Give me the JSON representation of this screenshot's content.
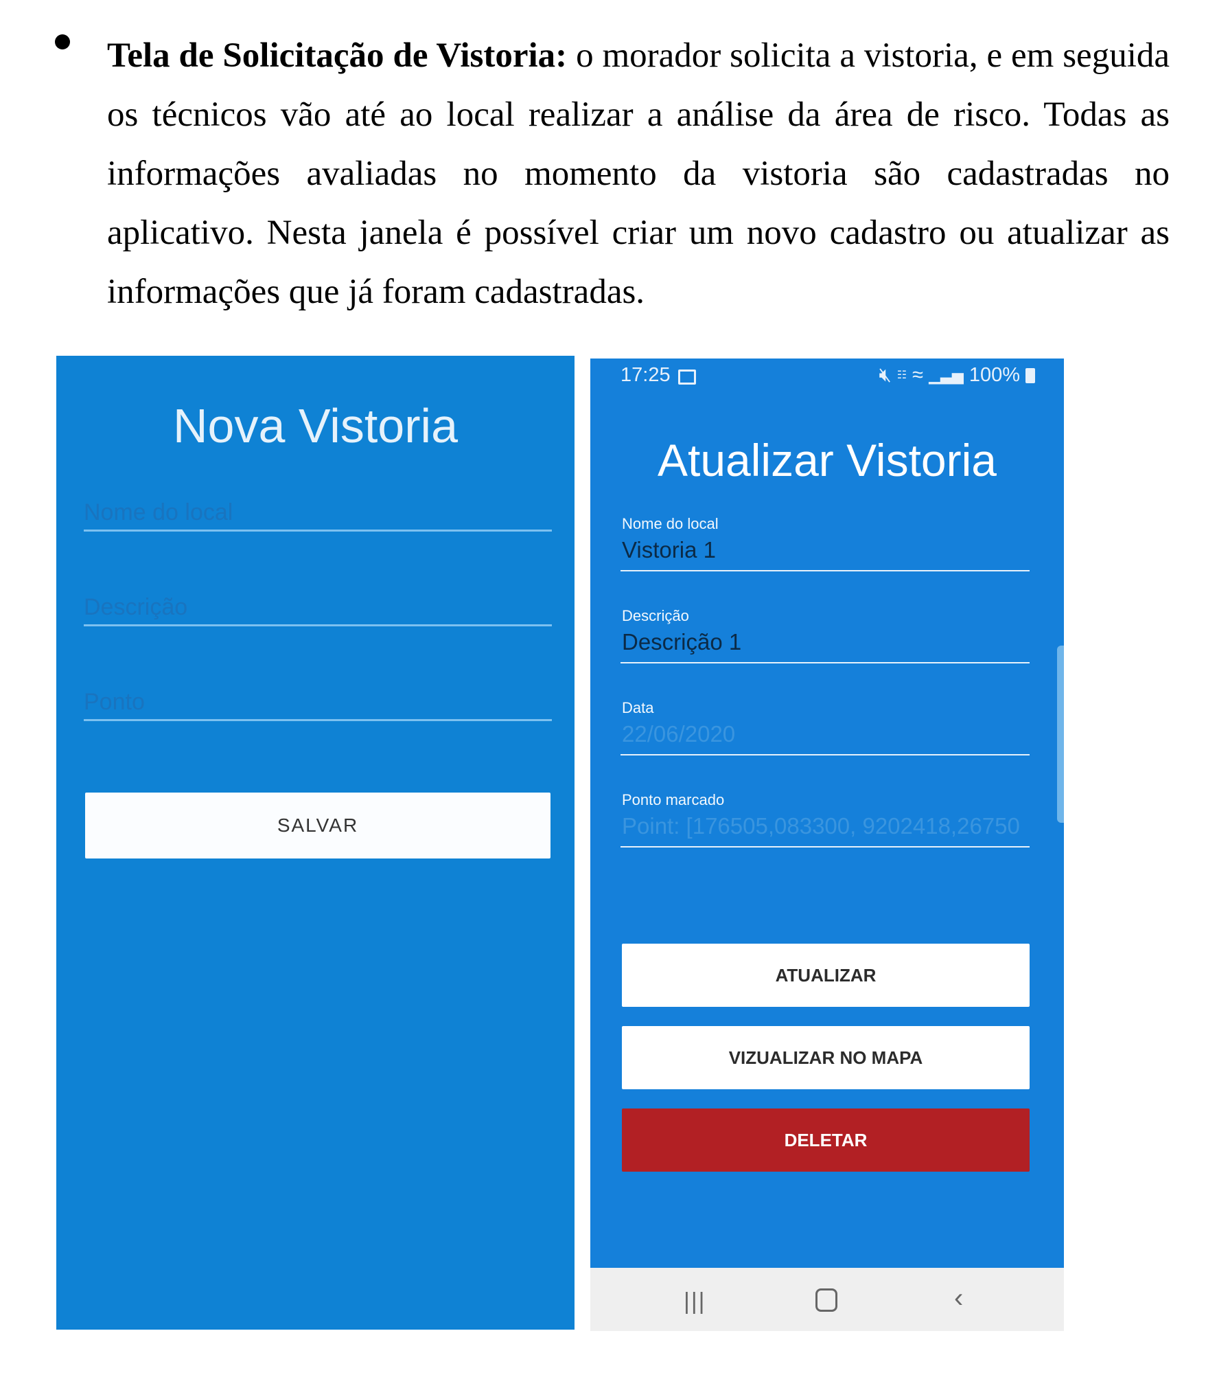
{
  "document": {
    "bold_lead": "Tela de Solicitação de Vistoria:",
    "body": " o morador solicita a vistoria, e em seguida os técnicos vão até ao local realizar a análise da área de risco. Todas as informações avaliadas no momento da vistoria são cadastradas no aplicativo. Nesta janela é possível criar um novo cadastro ou atualizar as informações que já foram cadastradas."
  },
  "nova_vistoria": {
    "title": "Nova Vistoria",
    "fields": [
      {
        "placeholder": "Nome do local"
      },
      {
        "placeholder": "Descrição"
      },
      {
        "placeholder": "Ponto"
      }
    ],
    "save_label": "SALVAR"
  },
  "atualizar_vistoria": {
    "status_bar": {
      "time": "17:25",
      "battery": "100%",
      "icons": [
        "gallery-icon",
        "mute-icon",
        "volte-icon",
        "wifi-icon",
        "signal-icon",
        "battery-icon"
      ]
    },
    "title": "Atualizar Vistoria",
    "fields": [
      {
        "label": "Nome do local",
        "value": "Vistoria 1"
      },
      {
        "label": "Descrição",
        "value": "Descrição 1"
      },
      {
        "label": "Data",
        "value": "22/06/2020"
      },
      {
        "label": "Ponto marcado",
        "value": "Point: [176505,083300, 9202418,26750"
      }
    ],
    "buttons": {
      "update": "ATUALIZAR",
      "map": "VIZUALIZAR NO MAPA",
      "delete": "DELETAR"
    },
    "nav_icons": [
      "recent-apps-icon",
      "home-icon",
      "back-icon"
    ]
  },
  "colors": {
    "screen_blue": "#0f82d4",
    "delete_red": "#b22024"
  }
}
